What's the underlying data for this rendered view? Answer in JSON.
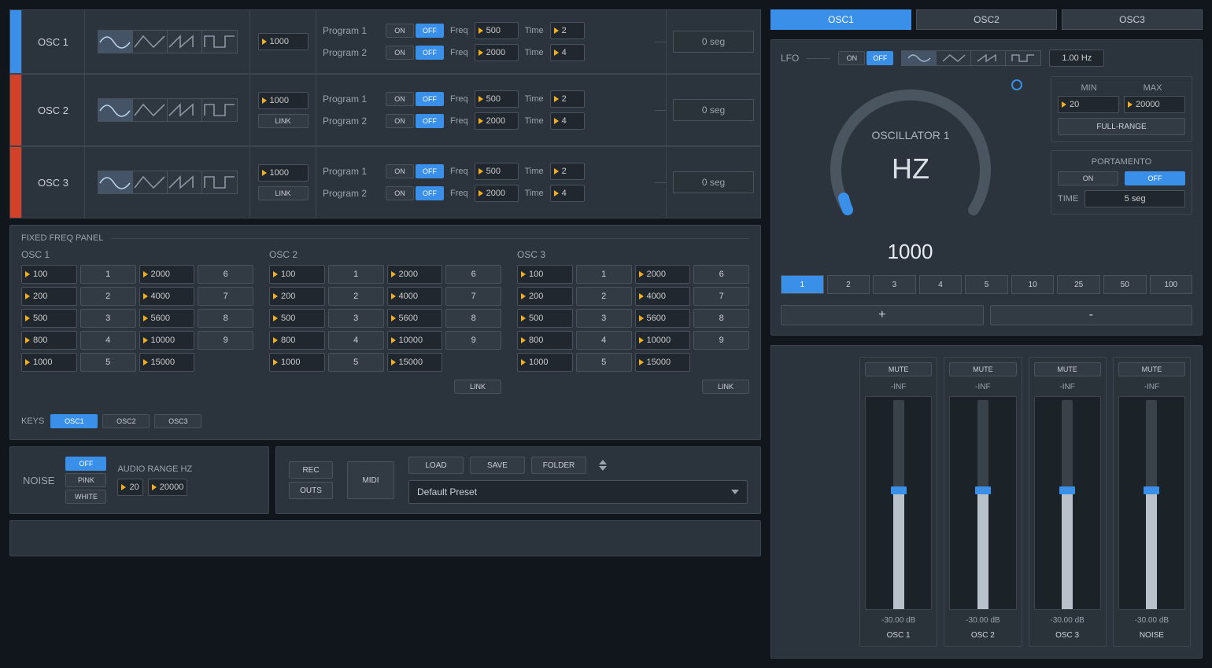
{
  "osc_rows": [
    {
      "name": "OSC 1",
      "color": "blue",
      "freq": "1000",
      "link": false,
      "segments": "0 seg",
      "programs": [
        {
          "label": "Program 1",
          "on": "ON",
          "off": "OFF",
          "freq": "500",
          "time": "2"
        },
        {
          "label": "Program 2",
          "on": "ON",
          "off": "OFF",
          "freq": "2000",
          "time": "4"
        }
      ]
    },
    {
      "name": "OSC 2",
      "color": "red",
      "freq": "1000",
      "link": true,
      "segments": "0 seg",
      "programs": [
        {
          "label": "Program 1",
          "on": "ON",
          "off": "OFF",
          "freq": "500",
          "time": "2"
        },
        {
          "label": "Program 2",
          "on": "ON",
          "off": "OFF",
          "freq": "2000",
          "time": "4"
        }
      ]
    },
    {
      "name": "OSC 3",
      "color": "red",
      "freq": "1000",
      "link": true,
      "segments": "0 seg",
      "programs": [
        {
          "label": "Program 1",
          "on": "ON",
          "off": "OFF",
          "freq": "500",
          "time": "2"
        },
        {
          "label": "Program 2",
          "on": "ON",
          "off": "OFF",
          "freq": "2000",
          "time": "4"
        }
      ]
    }
  ],
  "row_labels": {
    "freq": "Freq",
    "time": "Time",
    "link": "LINK"
  },
  "ffp": {
    "title": "FIXED FREQ PANEL",
    "cols": [
      {
        "name": "OSC 1",
        "link": false
      },
      {
        "name": "OSC 2",
        "link": true
      },
      {
        "name": "OSC 3",
        "link": true
      }
    ],
    "freqs": [
      "100",
      "200",
      "500",
      "800",
      "1000",
      "2000",
      "4000",
      "5600",
      "10000",
      "15000"
    ],
    "presets": [
      "1",
      "2",
      "3",
      "4",
      "5",
      "6",
      "7",
      "8",
      "9"
    ],
    "keys_label": "KEYS",
    "keys": [
      {
        "label": "OSC1",
        "on": true
      },
      {
        "label": "OSC2",
        "on": false
      },
      {
        "label": "OSC3",
        "on": false
      }
    ],
    "link_label": "LINK"
  },
  "noise": {
    "label": "NOISE",
    "modes": [
      {
        "label": "OFF",
        "on": true
      },
      {
        "label": "PINK",
        "on": false
      },
      {
        "label": "WHITE",
        "on": false
      }
    ],
    "range_label": "AUDIO RANGE HZ",
    "range_min": "20",
    "range_max": "20000"
  },
  "transport": {
    "rec": "REC",
    "outs": "OUTS",
    "midi": "MIDI"
  },
  "preset": {
    "load": "LOAD",
    "save": "SAVE",
    "folder": "FOLDER",
    "current": "Default Preset"
  },
  "tabs": [
    {
      "label": "OSC1",
      "on": true
    },
    {
      "label": "OSC2",
      "on": false
    },
    {
      "label": "OSC3",
      "on": false
    }
  ],
  "lfo": {
    "label": "LFO",
    "on": "ON",
    "off": "OFF",
    "rate": "1.00 Hz"
  },
  "detail": {
    "title": "OSCILLATOR 1",
    "unit": "HZ",
    "value": "1000",
    "min_label": "MIN",
    "max_label": "MAX",
    "min": "20",
    "max": "20000",
    "full": "FULL-RANGE",
    "port_label": "PORTAMENTO",
    "port_on": "ON",
    "port_off": "OFF",
    "time_label": "TIME",
    "time": "5 seg",
    "steps": [
      "1",
      "2",
      "3",
      "4",
      "5",
      "10",
      "25",
      "50",
      "100"
    ],
    "step_active": "1",
    "plus": "+",
    "minus": "-"
  },
  "mixer": {
    "mute": "MUTE",
    "inf": "-INF",
    "db": "-30.00 dB",
    "channels": [
      "OSC 1",
      "OSC 2",
      "OSC 3",
      "NOISE"
    ]
  }
}
